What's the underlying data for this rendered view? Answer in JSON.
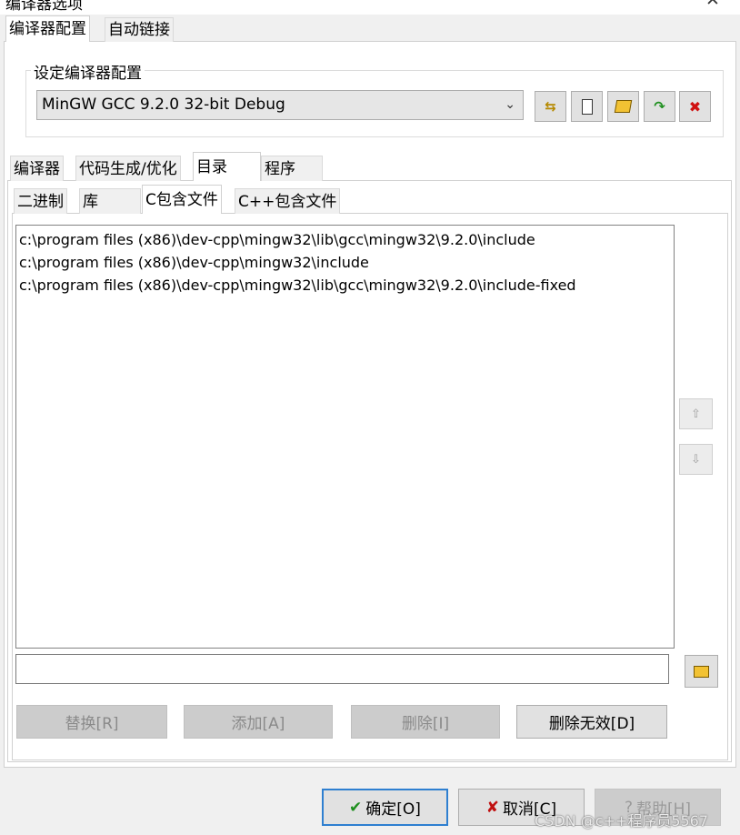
{
  "window": {
    "title": "编译器选项",
    "close_glyph": "✕"
  },
  "top_tabs": [
    {
      "label": "编译器配置",
      "active": true
    },
    {
      "label": "自动链接",
      "active": false
    }
  ],
  "config_group": {
    "label": "设定编译器配置",
    "selected": "MinGW GCC 9.2.0 32-bit Debug",
    "tools": [
      {
        "icon": "rename-config-icon",
        "glyph": "⇆"
      },
      {
        "icon": "new-config-icon",
        "glyph": "▯"
      },
      {
        "icon": "open-config-icon",
        "glyph": "📂"
      },
      {
        "icon": "apply-config-icon",
        "glyph": "↷"
      },
      {
        "icon": "delete-config-icon",
        "glyph": "✖"
      }
    ]
  },
  "section_tabs": [
    {
      "label": "编译器",
      "active": false
    },
    {
      "label": "代码生成/优化",
      "active": false
    },
    {
      "label": "目录",
      "active": true
    },
    {
      "label": "程序",
      "active": false
    }
  ],
  "dir_tabs": [
    {
      "label": "二进制",
      "active": false
    },
    {
      "label": "库",
      "active": false
    },
    {
      "label": "C包含文件",
      "active": true
    },
    {
      "label": "C++包含文件",
      "active": false
    }
  ],
  "directories": [
    "c:\\program files (x86)\\dev-cpp\\mingw32\\lib\\gcc\\mingw32\\9.2.0\\include",
    "c:\\program files (x86)\\dev-cpp\\mingw32\\include",
    "c:\\program files (x86)\\dev-cpp\\mingw32\\lib\\gcc\\mingw32\\9.2.0\\include-fixed"
  ],
  "move_buttons": {
    "up_glyph": "⇧",
    "down_glyph": "⇩"
  },
  "path_input": {
    "value": "",
    "placeholder": ""
  },
  "action_buttons": [
    {
      "label": "替换[R]",
      "enabled": false
    },
    {
      "label": "添加[A]",
      "enabled": false
    },
    {
      "label": "删除[I]",
      "enabled": false
    },
    {
      "label": "删除无效[D]",
      "enabled": true
    }
  ],
  "bottom_buttons": {
    "ok": "确定[O]",
    "cancel": "取消[C]",
    "help": "帮助[H]"
  },
  "watermark": "CSDN @c++程序员5567"
}
